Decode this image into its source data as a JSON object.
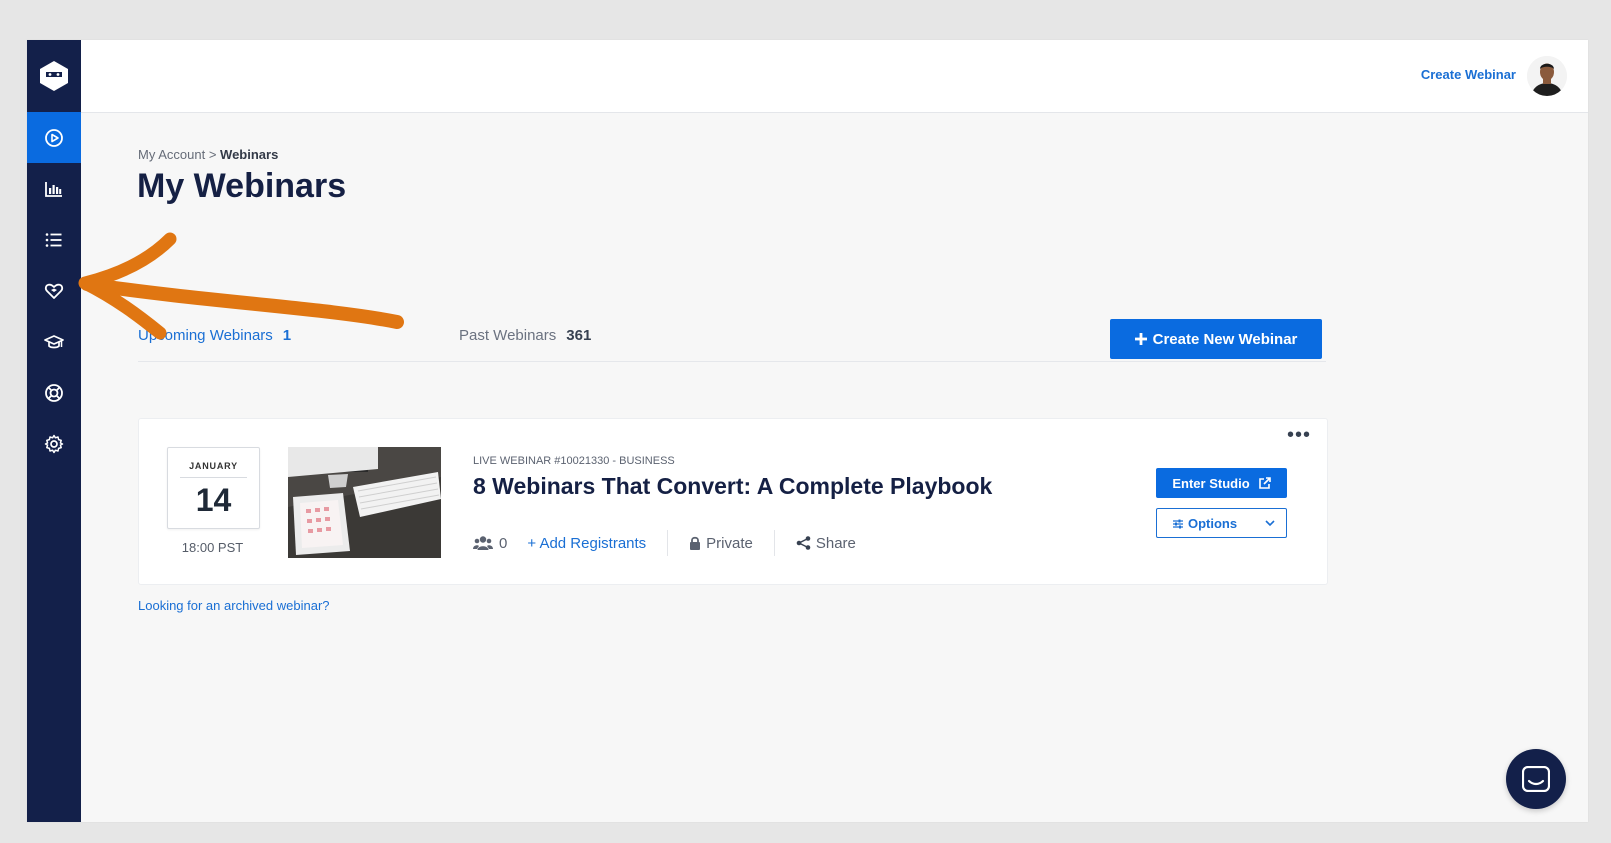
{
  "topbar": {
    "create_link": "Create Webinar"
  },
  "sidebar": {
    "items": [
      {
        "icon": "play-circle-icon",
        "active": true
      },
      {
        "icon": "bar-chart-icon"
      },
      {
        "icon": "list-icon"
      },
      {
        "icon": "heart-handshake-icon"
      },
      {
        "icon": "graduation-cap-icon"
      },
      {
        "icon": "lifebuoy-icon"
      },
      {
        "icon": "gear-icon"
      }
    ]
  },
  "breadcrumb": {
    "parent": "My Account",
    "separator": " > ",
    "current": "Webinars"
  },
  "page": {
    "title": "My Webinars"
  },
  "tabs": [
    {
      "label": "Upcoming Webinars",
      "count": "1",
      "active": true
    },
    {
      "label": "Past Webinars",
      "count": "361"
    }
  ],
  "create_button": "Create New Webinar",
  "webinar": {
    "month": "JANUARY",
    "day": "14",
    "time": "18:00 PST",
    "meta": "LIVE WEBINAR #10021330 - BUSINESS",
    "title": "8 Webinars That Convert: A Complete Playbook",
    "registrants": "0",
    "add_registrants": "+ Add Registrants",
    "privacy": "Private",
    "share": "Share",
    "enter_studio": "Enter Studio",
    "options": "Options",
    "more": "•••"
  },
  "archive_link": "Looking for an archived webinar?",
  "colors": {
    "sidebar": "#13204a",
    "accent": "#0a6be0",
    "annotation": "#e07612"
  }
}
